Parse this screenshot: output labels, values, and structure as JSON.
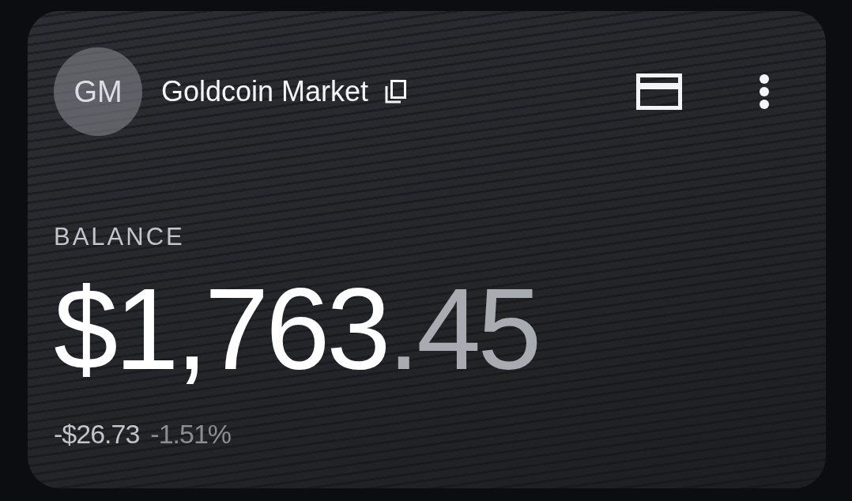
{
  "account": {
    "avatar_initials": "GM",
    "name": "Goldcoin Market"
  },
  "balance": {
    "label": "BALANCE",
    "amount_whole": "$1,763",
    "amount_fraction": ".45",
    "change_amount": "-$26.73",
    "change_percent": "-1.51%"
  }
}
